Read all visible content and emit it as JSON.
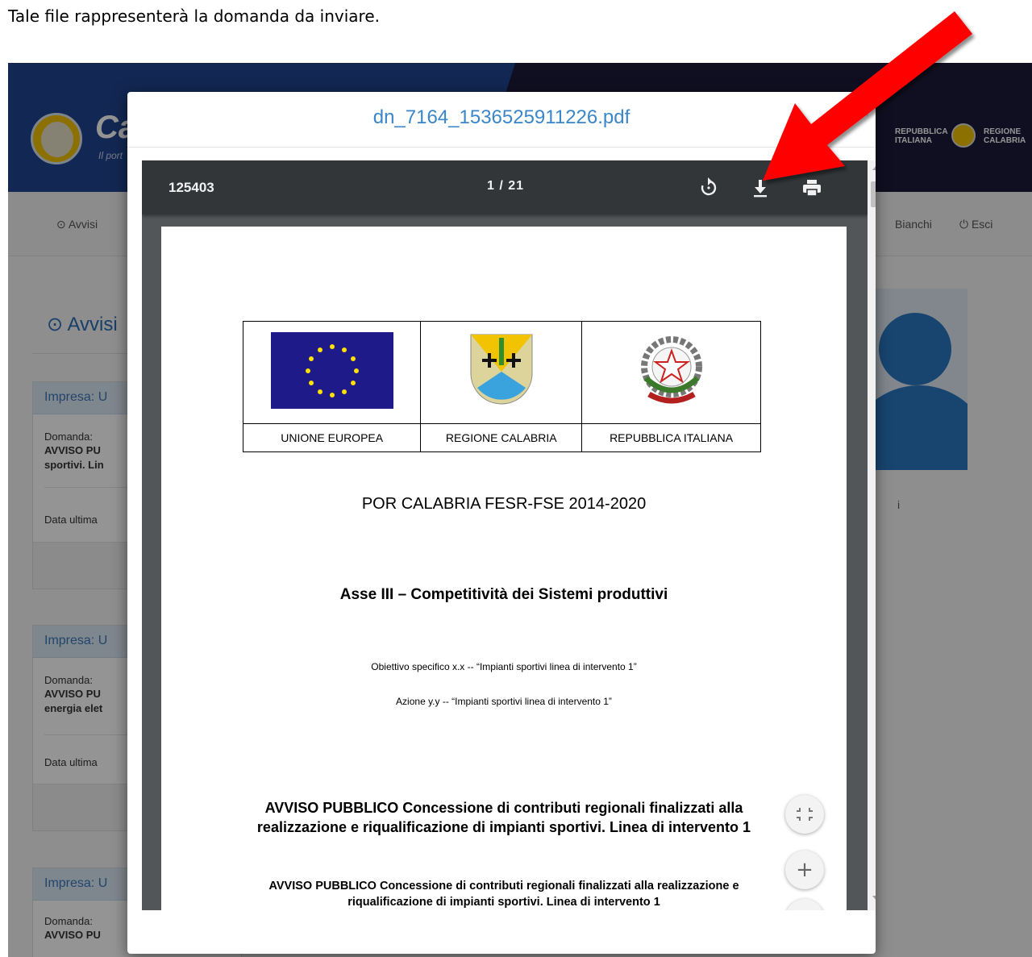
{
  "caption": "Tale file rappresenterà la domanda da inviare.",
  "app": {
    "brand_text": "Ca",
    "brand_sub": "Il port",
    "header_right_1": "REPUBBLICA ITALIANA",
    "header_right_2": "REGIONE CALABRIA",
    "nav": {
      "avvisi": "⊙ Avvisi",
      "bianchi": "Bianchi",
      "esci": "⏻ Esci"
    },
    "section_title": "⊙ Avvisi",
    "cards": [
      {
        "head": "Impresa: U",
        "lbl": "Domanda:",
        "bold1": "AVVISO PU",
        "bold2": "sportivi. Lin",
        "date": "Data ultima"
      },
      {
        "head": "Impresa: U",
        "lbl": "Domanda:",
        "bold1": "AVVISO PU",
        "bold2": "energia elet",
        "date": "Data ultima"
      },
      {
        "head": "Impresa: U",
        "lbl": "Domanda:",
        "bold1": "AVVISO PU"
      }
    ],
    "right_letter": "i"
  },
  "modal": {
    "title": "dn_7164_1536525911226.pdf",
    "close_label": "×"
  },
  "viewer": {
    "doc_title": "125403",
    "page_indicator": "1 / 21",
    "icons": [
      "rotate-icon",
      "download-icon",
      "print-icon",
      "fit-page-icon",
      "zoom-in-icon",
      "zoom-out-icon"
    ],
    "zoom_in": "+",
    "zoom_out": "−"
  },
  "pdf": {
    "logo_captions": [
      "UNIONE EUROPEA",
      "REGIONE CALABRIA",
      "REPUBBLICA ITALIANA"
    ],
    "line1": "POR CALABRIA FESR-FSE 2014-2020",
    "line2": "Asse III – Competitività dei Sistemi produttivi",
    "line3": "Obiettivo specifico x.x -- “Impianti sportivi linea di intervento 1”",
    "line4": "Azione y.y -- “Impianti sportivi linea di intervento 1”",
    "line5": "AVVISO PUBBLICO Concessione di contributi regionali finalizzati alla realizzazione e riqualificazione di impianti sportivi. Linea di intervento 1",
    "line6": "AVVISO PUBBLICO Concessione di contributi regionali finalizzati alla realizzazione e riqualificazione di impianti sportivi. Linea di intervento 1"
  },
  "colors": {
    "arrow": "#ff0000",
    "modal_title": "#3a86c8",
    "toolbar": "#323639"
  }
}
